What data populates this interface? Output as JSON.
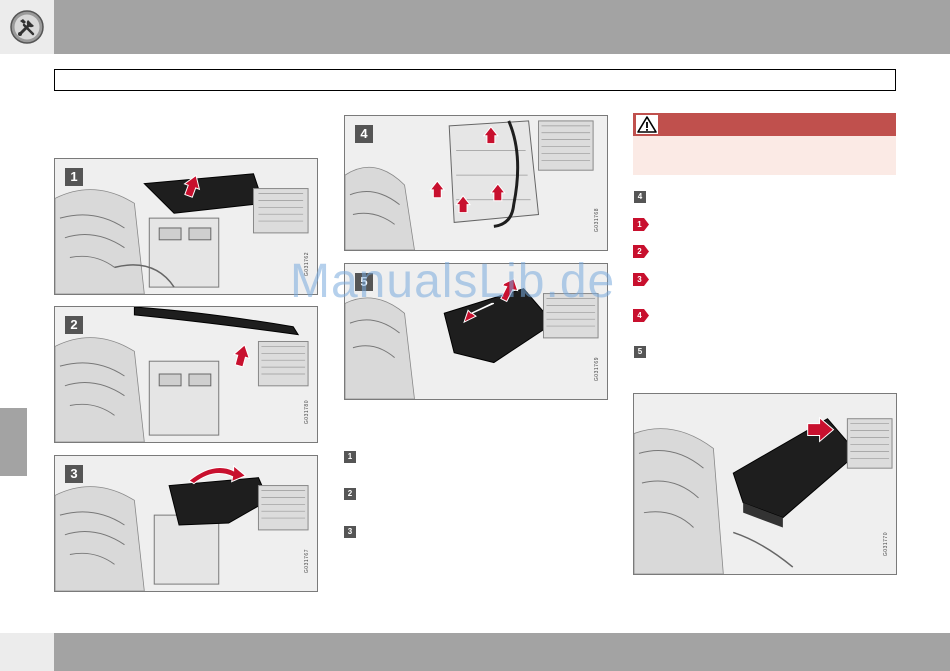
{
  "header": {
    "section_icon": "wrench-screwdriver-icon"
  },
  "figures": [
    {
      "num": "1",
      "code": "G031762"
    },
    {
      "num": "2",
      "code": "G031780"
    },
    {
      "num": "3",
      "code": "G031767"
    },
    {
      "num": "4",
      "code": "G031768"
    },
    {
      "num": "5",
      "code": "G031769"
    },
    {
      "num": "",
      "code": "G031770"
    }
  ],
  "middle_steps": [
    "1",
    "2",
    "3"
  ],
  "right_steps": [
    {
      "kind": "square",
      "num": "4"
    },
    {
      "kind": "arrow",
      "num": "1"
    },
    {
      "kind": "arrow",
      "num": "2"
    },
    {
      "kind": "arrow",
      "num": "3"
    },
    {
      "kind": "arrow",
      "num": "4"
    },
    {
      "kind": "square",
      "num": "5"
    }
  ],
  "warning": {
    "icon": "warning-triangle-icon"
  },
  "watermark": "ManualsLib.de",
  "colors": {
    "bar": "#a3a3a3",
    "warning_red": "#c0504d",
    "warning_bg": "#fbeae5",
    "arrow_red": "#c8102e"
  }
}
